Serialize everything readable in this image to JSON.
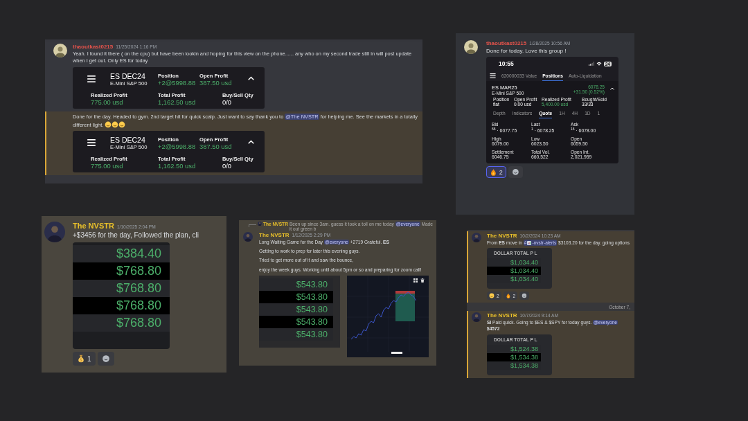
{
  "panels": [
    {
      "messages": [
        {
          "kind": "message",
          "author": "thaoutkast0215",
          "color": "#e5534b",
          "timestamp": "11/25/2024 1:16 PM",
          "highlighted": false,
          "paragraphs": [
            [
              {
                "kind": "text",
                "text": "Yeah. I found it there ( on the cpu) but have been lookin and hoping for this view on the phone...... any who on my second trade still in will post update when I get out. Only ES for today"
              }
            ]
          ],
          "attachments": [
            {
              "kind": "trade-card",
              "symbol": "ES DEC24",
              "description": "E-Mini S&P 500",
              "top_stats": [
                {
                  "label": "Position",
                  "value": "+2@5998.88",
                  "positive": true
                },
                {
                  "label": "Open Profit",
                  "value": "387.50 usd",
                  "positive": true
                }
              ],
              "bottom_stats": [
                {
                  "label": "Realized Profit",
                  "value": "775.00 usd",
                  "positive": true
                },
                {
                  "label": "Total Profit",
                  "value": "1,162.50 usd",
                  "positive": true
                },
                {
                  "label": "Buy/Sell Qty",
                  "value": "0/0",
                  "positive": false
                }
              ]
            }
          ]
        },
        {
          "kind": "message",
          "highlighted": true,
          "paragraphs": [
            [
              {
                "kind": "text",
                "text": "Done for the day. Headed to gym. 2nd target hit for quick scalp. Just want to say thank you to "
              },
              {
                "kind": "mention",
                "text": "@The NVSTR"
              },
              {
                "kind": "text",
                "text": " for helping me. See the markets in a totally different light. "
              },
              {
                "kind": "emoji"
              },
              {
                "kind": "emoji"
              },
              {
                "kind": "emoji"
              }
            ]
          ],
          "attachments": [
            {
              "kind": "trade-card",
              "symbol": "ES DEC24",
              "description": "E-Mini S&P 500",
              "top_stats": [
                {
                  "label": "Position",
                  "value": "+2@5998.88",
                  "positive": true
                },
                {
                  "label": "Open Profit",
                  "value": "387.50 usd",
                  "positive": true
                }
              ],
              "bottom_stats": [
                {
                  "label": "Realized Profit",
                  "value": "775.00 usd",
                  "positive": true
                },
                {
                  "label": "Total Profit",
                  "value": "1,162.50 usd",
                  "positive": true
                },
                {
                  "label": "Buy/Sell Qty",
                  "value": "0/0",
                  "positive": false
                }
              ]
            }
          ]
        }
      ]
    },
    {
      "messages": [
        {
          "kind": "message",
          "author": "thaoutkast0215",
          "color": "#e5534b",
          "timestamp": "1/28/2025 10:56 AM",
          "paragraphs": [
            [
              {
                "kind": "text",
                "text": "Done for today. Love this group !"
              }
            ]
          ],
          "attachments": [
            {
              "kind": "phone-quote",
              "clock": "10:55",
              "battery": "24",
              "tabs": [
                {
                  "label": "620000033 Value",
                  "selected": false
                },
                {
                  "label": "Positions",
                  "selected": true
                },
                {
                  "label": "Auto-Liquidation",
                  "selected": false
                }
              ],
              "symbol": "ES MAR25",
              "description": "E-Mini S&P 500",
              "price": "6078.25",
              "change": "+31.50 (0.52%)",
              "stats": [
                {
                  "label": "Position",
                  "value": "flat",
                  "positive": false
                },
                {
                  "label": "Open Profit",
                  "value": "0.00 usd",
                  "positive": false
                },
                {
                  "label": "Realized Profit",
                  "value": "5,400.00 usd",
                  "positive": true
                },
                {
                  "label": "Bought/Sold",
                  "value": "33/33",
                  "positive": false
                }
              ],
              "subtabs": [
                {
                  "label": "Depth",
                  "selected": false
                },
                {
                  "label": "Indicators",
                  "selected": false
                },
                {
                  "label": "Quote",
                  "selected": true
                },
                {
                  "label": "1H",
                  "selected": false
                },
                {
                  "label": "4H",
                  "selected": false
                },
                {
                  "label": "1D",
                  "selected": false
                },
                {
                  "label": "1",
                  "selected": false
                }
              ],
              "quotes": [
                {
                  "label": "Bid",
                  "value": "$^{66}$ · 6077.75"
                },
                {
                  "label": "Last",
                  "value": "$^{1}$ · 6078.25"
                },
                {
                  "label": "Ask",
                  "value": "$^{16}$ · 6078.00"
                },
                {
                  "label": "High",
                  "value": "6079.00"
                },
                {
                  "label": "Low",
                  "value": "6023.50"
                },
                {
                  "label": "Open",
                  "value": "6059.50"
                },
                {
                  "label": "Settlement",
                  "value": "6046.75"
                },
                {
                  "label": "Total Vol.",
                  "value": "660,522"
                },
                {
                  "label": "Open Int.",
                  "value": "2,021,959"
                }
              ]
            }
          ],
          "reactions": [
            {
              "kind": "fire",
              "count": "2",
              "selected": true
            }
          ]
        }
      ]
    },
    {
      "messages": [
        {
          "kind": "message",
          "author": "The NVSTR",
          "color": "#e9c02a",
          "timestamp": "1/10/2025 2:04 PM",
          "paragraphs": [
            [
              {
                "kind": "text",
                "text": "+$3456 for the day, Followed the plan, cli"
              }
            ]
          ],
          "attachments": [
            {
              "kind": "pnl-list",
              "values": [
                "$384.40",
                "$768.80",
                "$768.80",
                "$768.80",
                "$768.80"
              ]
            }
          ],
          "reactions": [
            {
              "kind": "money-bag",
              "count": "1",
              "selected": false
            }
          ]
        }
      ]
    },
    {
      "messages": [
        {
          "kind": "message",
          "reply": {
            "author": "The NVSTR",
            "segments": [
              {
                "kind": "text",
                "text": "Been up since 3am. guess it took a toll on me today "
              },
              {
                "kind": "mention",
                "text": "@everyone"
              },
              {
                "kind": "text",
                "text": " Made it out green b"
              }
            ]
          },
          "author": "The NVSTR",
          "color": "#e9c02a",
          "timestamp": "1/12/2025 2:29 PM",
          "paragraphs": [
            [
              {
                "kind": "text",
                "text": "Long Waiting Game for the Day "
              },
              {
                "kind": "mention",
                "text": "@everyone"
              },
              {
                "kind": "text",
                "text": " +2719 Grateful. **ES**"
              }
            ],
            [
              {
                "kind": "text",
                "text": "Getting to work to prep for later this evening guys."
              }
            ],
            [
              {
                "kind": "text",
                "text": "Tried to get more out of it and saw the bounce,"
              }
            ],
            [
              {
                "kind": "text",
                "text": "enjoy the week guys. Working until about 5pm or so and preparing for zoom call!"
              }
            ]
          ],
          "attachments": [
            {
              "kind": "pnl-list",
              "values": [
                "$543.80",
                "$543.80",
                "$543.80",
                "$543.80",
                "$543.80"
              ]
            },
            {
              "kind": "chart-image"
            }
          ]
        }
      ]
    },
    {
      "messages": [
        {
          "kind": "message",
          "author": "The NVSTR",
          "color": "#e9c02a",
          "timestamp": "10/2/2024 10:23 AM",
          "highlighted": true,
          "paragraphs": [
            [
              {
                "kind": "text",
                "text": "From **ES** move in "
              },
              {
                "kind": "channel",
                "prefix": "#",
                "text": "-nvstr-alerts"
              },
              {
                "kind": "text",
                "text": " $3103.20 for the day. going options"
              }
            ]
          ],
          "attachments": [
            {
              "kind": "pnl-list",
              "header": "DOLLAR TOTAL P L",
              "values": [
                "$1,034.40",
                "$1,034.40",
                "$1,034.40"
              ]
            }
          ],
          "reactions": [
            {
              "kind": "face",
              "count": "2",
              "selected": false
            },
            {
              "kind": "fire",
              "count": "2",
              "selected": false
            }
          ]
        },
        {
          "kind": "divider",
          "text": "October 7,"
        },
        {
          "kind": "message",
          "author": "The NVSTR",
          "color": "#e9c02a",
          "timestamp": "10/7/2024 9:14 AM",
          "highlighted": true,
          "paragraphs": [
            [
              {
                "kind": "text",
                "text": "**SI** Paid quick. Going to $ES & $SPY for today guys. "
              },
              {
                "kind": "mention",
                "text": "@everyone"
              },
              {
                "kind": "text",
                "text": " **$4572**"
              }
            ]
          ],
          "attachments": [
            {
              "kind": "pnl-list",
              "header": "DOLLAR TOTAL P L",
              "values": [
                "$1,524.38",
                "$1,534.38",
                "$1,534.38"
              ]
            }
          ]
        }
      ]
    }
  ]
}
